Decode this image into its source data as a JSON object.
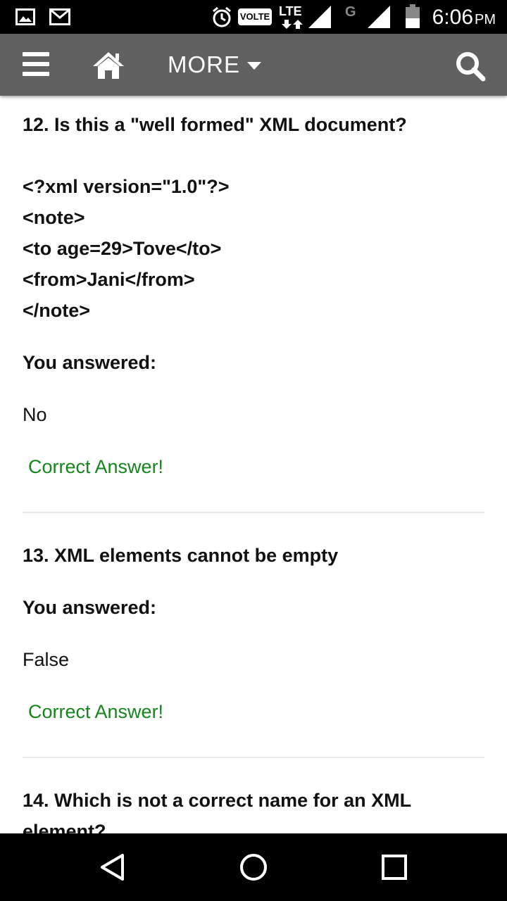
{
  "status_bar": {
    "time": "6:06",
    "ampm": "PM",
    "volte": "VOLTE",
    "lte": "LTE",
    "g": "G",
    "icons": [
      "image-icon",
      "gmail-icon",
      "alarm-icon",
      "signal-icon",
      "battery-icon"
    ]
  },
  "app_bar": {
    "more_label": "MORE",
    "icons": [
      "menu-icon",
      "home-icon",
      "caret-down-icon",
      "search-icon"
    ]
  },
  "questions": [
    {
      "title": "12. Is this a \"well formed\" XML document?",
      "code": [
        "<?xml version=\"1.0\"?>",
        "<note>",
        "<to age=29>Tove</to>",
        "<from>Jani</from>",
        "</note>"
      ],
      "you_answered": "You answered:",
      "answer": "No",
      "result": "Correct Answer!"
    },
    {
      "title": "13. XML elements cannot be empty",
      "you_answered": "You answered:",
      "answer": "False",
      "result": "Correct Answer!"
    },
    {
      "title_line1": "14. Which is not a correct name for an XML",
      "title_line2": "element?"
    }
  ],
  "colors": {
    "app_bar": "#616161",
    "correct": "#13871a"
  },
  "nav_bar": {
    "icons": [
      "back-icon",
      "home-circle-icon",
      "recents-icon"
    ]
  }
}
